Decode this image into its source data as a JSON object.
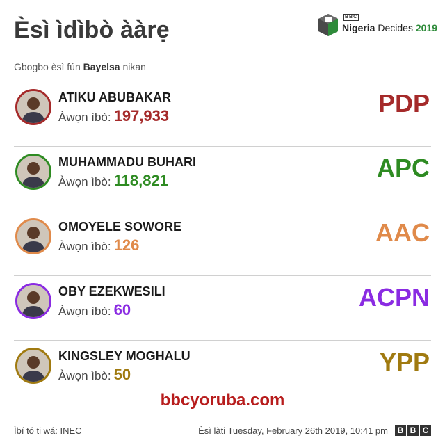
{
  "header": {
    "title": "Èsì ìdìbò ààrẹ",
    "subtitle_prefix": "Gbogbo èsì fún",
    "subtitle_state": "Bayelsa",
    "subtitle_suffix": "nikan",
    "logo": {
      "bbc_mini": "BBC",
      "brand_bold": "Nigeria",
      "brand_text": "Decides",
      "brand_year": "2019",
      "icon": "ballot-box-icon"
    }
  },
  "votes_label": "Àwọn ìbò:",
  "candidates": [
    {
      "name": "ATIKU ABUBAKAR",
      "votes": "197,933",
      "party": "PDP",
      "color": "#a52a2a"
    },
    {
      "name": "MUHAMMADU BUHARI",
      "votes": "118,821",
      "party": "APC",
      "color": "#2e8b22"
    },
    {
      "name": "OMOYELE SOWORE",
      "votes": "126",
      "party": "AAC",
      "color": "#e08a4a"
    },
    {
      "name": "OBY EZEKWESILI",
      "votes": "60",
      "party": "ACPN",
      "color": "#8a2be2"
    },
    {
      "name": "KINGSLEY MOGHALU",
      "votes": "50",
      "party": "YPP",
      "color": "#a07a10"
    }
  ],
  "site": "bbcyoruba.com",
  "footer": {
    "source": "Ìbí tó ti wá: INEC",
    "updated": "Èsì làti Tuesday, February 26th 2019, 10:41 pm",
    "bbc_letters": [
      "B",
      "B",
      "C"
    ]
  }
}
